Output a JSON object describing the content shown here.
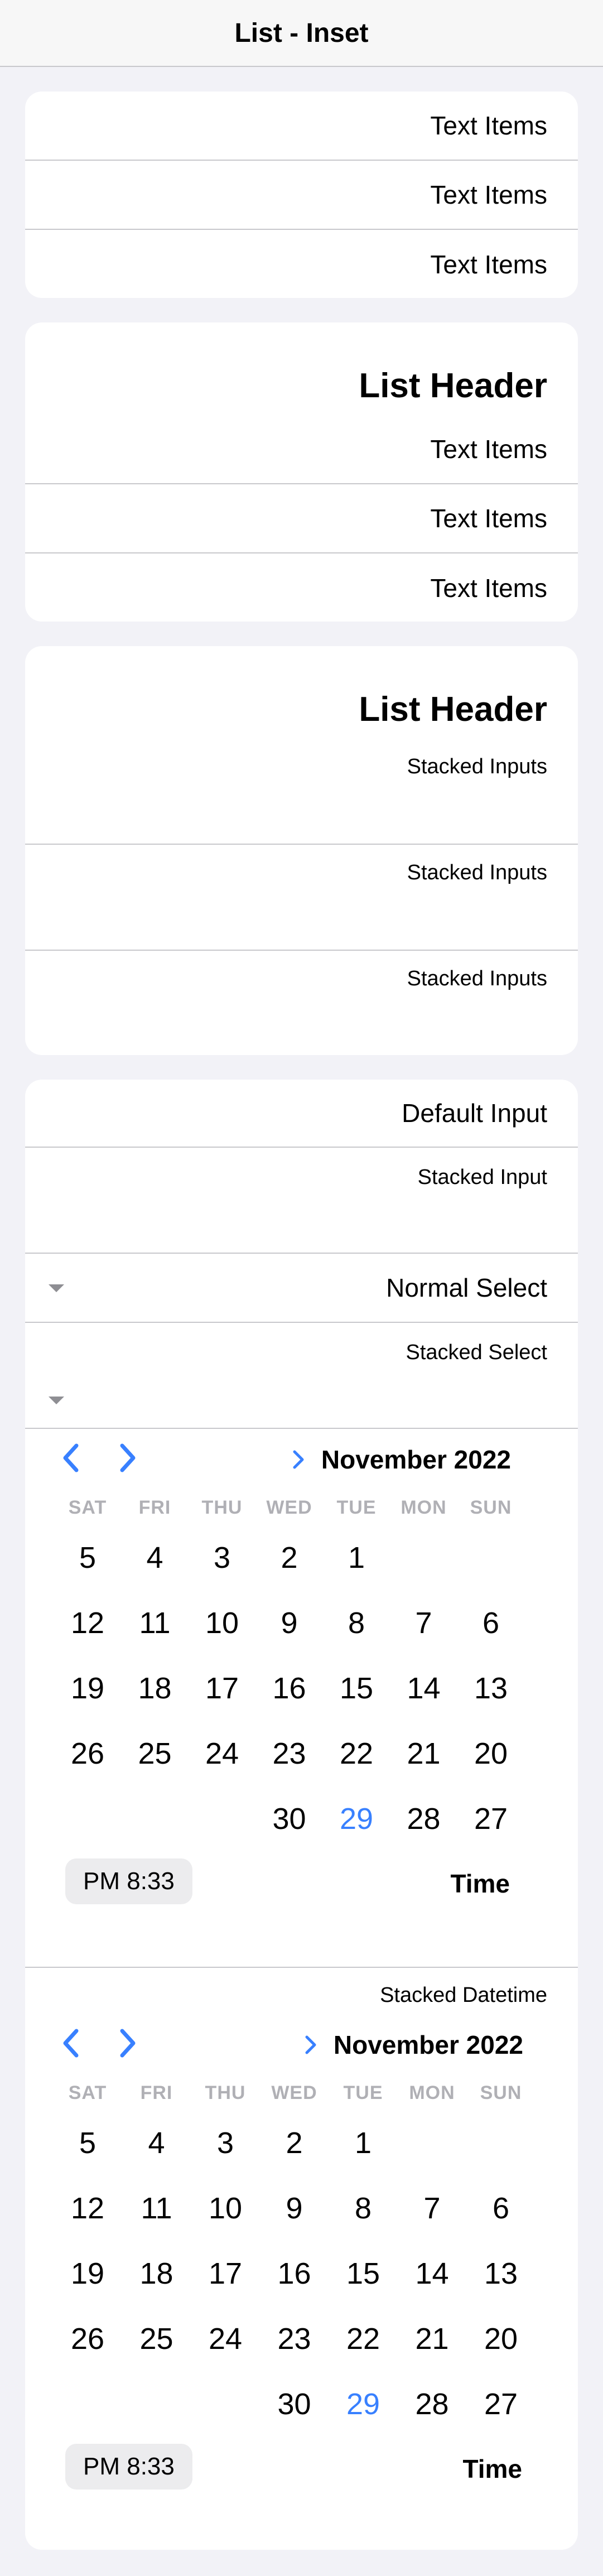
{
  "toolbar": {
    "title": "List - Inset"
  },
  "card1": {
    "items": [
      "Text Items",
      "Text Items",
      "Text Items"
    ]
  },
  "card2": {
    "header": "List Header",
    "items": [
      "Text Items",
      "Text Items",
      "Text Items"
    ]
  },
  "card3": {
    "header": "List Header",
    "items": [
      "Stacked Inputs",
      "Stacked Inputs",
      "Stacked Inputs"
    ]
  },
  "card4": {
    "default_input": "Default Input",
    "stacked_input": "Stacked Input",
    "normal_select": "Normal Select",
    "stacked_select": "Stacked Select",
    "stacked_datetime": "Stacked Datetime"
  },
  "calendar": {
    "month_label": "November 2022",
    "weekdays": [
      "SAT",
      "FRI",
      "THU",
      "WED",
      "TUE",
      "MON",
      "SUN"
    ],
    "weeks": [
      [
        "5",
        "4",
        "3",
        "2",
        "1",
        "",
        ""
      ],
      [
        "12",
        "11",
        "10",
        "9",
        "8",
        "7",
        "6"
      ],
      [
        "19",
        "18",
        "17",
        "16",
        "15",
        "14",
        "13"
      ],
      [
        "26",
        "25",
        "24",
        "23",
        "22",
        "21",
        "20"
      ],
      [
        "",
        "",
        "",
        "30",
        "29",
        "28",
        "27"
      ]
    ],
    "today": "29",
    "time_value": "PM 8:33",
    "time_label": "Time"
  },
  "colors": {
    "accent": "#3880ff",
    "background": "#f2f2f7",
    "separator": "#c8c8cc"
  },
  "icons": {
    "prev": "chevron-left-icon",
    "next": "chevron-right-icon",
    "month": "chevron-right-icon",
    "select": "caret-down-icon"
  }
}
